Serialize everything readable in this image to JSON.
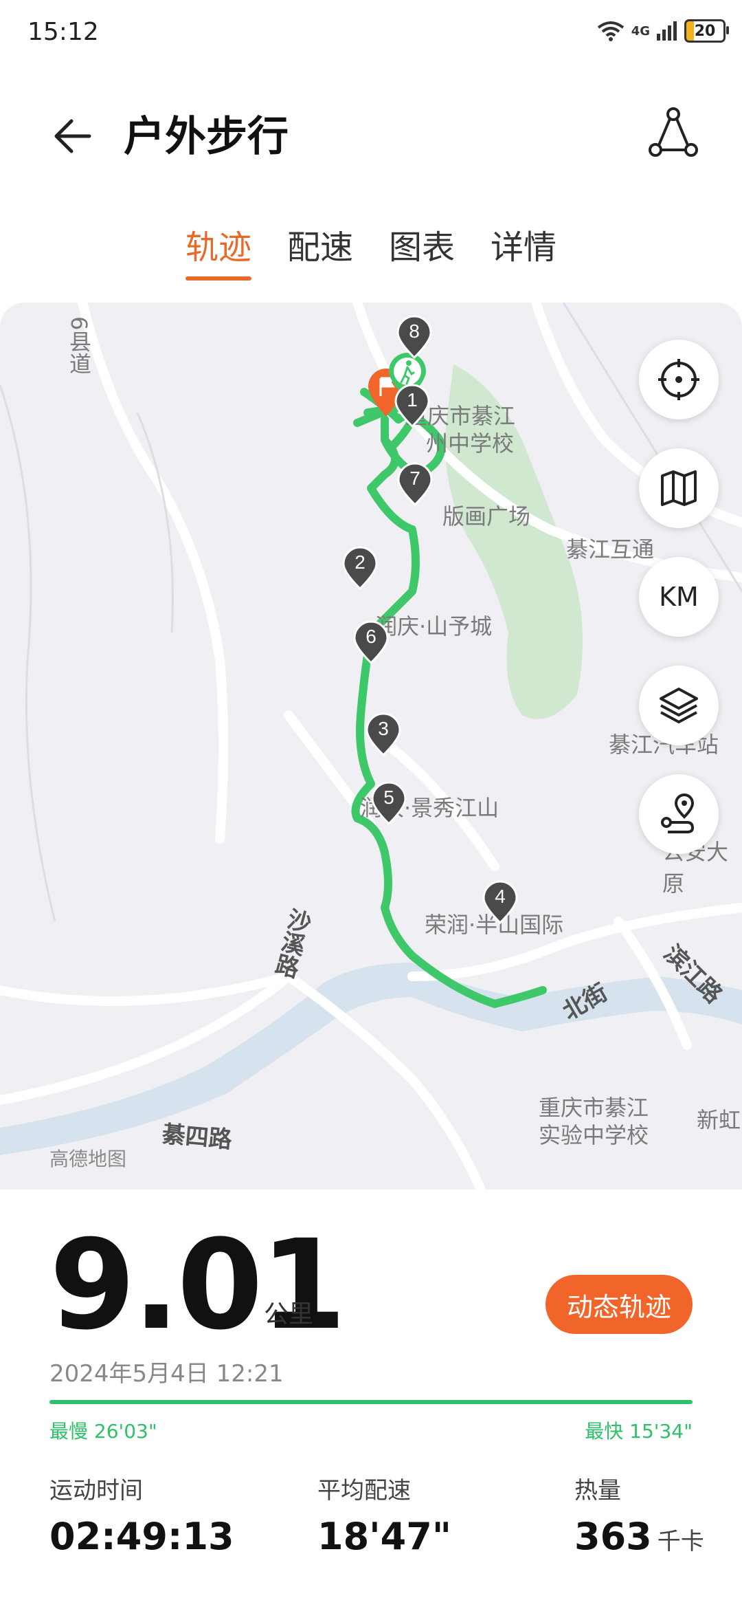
{
  "status": {
    "time": "15:12",
    "network": "4G",
    "battery": "20"
  },
  "header": {
    "title": "户外步行"
  },
  "tabs": [
    {
      "label": "轨迹",
      "active": true
    },
    {
      "label": "配速",
      "active": false
    },
    {
      "label": "图表",
      "active": false
    },
    {
      "label": "详情",
      "active": false
    }
  ],
  "map": {
    "labels": {
      "county_road": "6县道",
      "school1_line1": "重庆市綦江",
      "school1_line2": "州中学校",
      "plaza": "版画广场",
      "interchange": "綦江互通",
      "city1": "润庆·山予城",
      "bus_station": "綦江汽车站",
      "city2": "润庆·景秀江山",
      "police": "公安大原",
      "city3": "荣润·半山国际",
      "road_shaxi": "沙溪路",
      "road_beijie": "北街",
      "road_binjiang": "滨江路",
      "school2_line1": "重庆市綦江",
      "school2_line2": "实验中学校",
      "xinhong": "新虹",
      "road_qisi": "綦四路"
    },
    "credit": "高德地图",
    "km_label": "KM",
    "markers": [
      "8",
      "1",
      "7",
      "2",
      "6",
      "3",
      "5",
      "4"
    ],
    "colors": {
      "route": "#3ec86a",
      "start": "#f2652a",
      "river": "#d6e3ee",
      "park": "#cfe8cf"
    }
  },
  "summary": {
    "distance": "9.01",
    "distance_unit": "公里",
    "replay_label": "动态轨迹",
    "datetime": "2024年5月4日 12:21",
    "slowest": "最慢 26'03\"",
    "fastest": "最快 15'34\""
  },
  "stats": [
    {
      "label": "运动时间",
      "value": "02:49:13",
      "unit": ""
    },
    {
      "label": "平均配速",
      "value": "18'47\"",
      "unit": ""
    },
    {
      "label": "热量",
      "value": "363",
      "unit": "千卡"
    }
  ]
}
